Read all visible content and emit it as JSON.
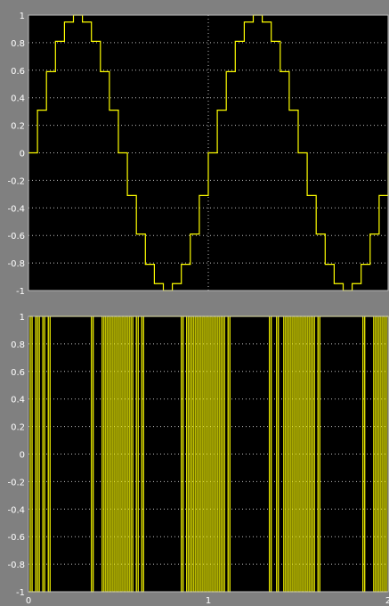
{
  "colors": {
    "figure_background": "#808080",
    "axes_background": "#000000",
    "trace": "#ffff00",
    "grid": "#bdbdbd",
    "tick_text": "#ffffff"
  },
  "chart_data": [
    {
      "type": "line",
      "step": true,
      "title": "",
      "xlabel": "",
      "ylabel": "",
      "xlim": [
        0,
        2
      ],
      "ylim": [
        -1,
        1
      ],
      "grid": true,
      "x_ticks": [
        0,
        1,
        2
      ],
      "x_tick_labels": [
        "",
        "",
        ""
      ],
      "y_ticks": [
        1,
        0.8,
        0.6,
        0.4,
        0.2,
        0,
        -0.2,
        -0.4,
        -0.6,
        -0.8,
        -1
      ],
      "y_tick_labels": [
        "1",
        "0.8",
        "0.6",
        "0.4",
        "0.2",
        "0",
        "-0.2",
        "-0.4",
        "-0.6",
        "-0.8",
        "-1"
      ],
      "series": [
        {
          "x": [
            0,
            0.05,
            0.1,
            0.15,
            0.2,
            0.25,
            0.3,
            0.35,
            0.4,
            0.45,
            0.5,
            0.55,
            0.6,
            0.65,
            0.7,
            0.75,
            0.8,
            0.85,
            0.9,
            0.95,
            1.0,
            1.05,
            1.1,
            1.15,
            1.2,
            1.25,
            1.3,
            1.35,
            1.4,
            1.45,
            1.5,
            1.55,
            1.6,
            1.65,
            1.7,
            1.75,
            1.8,
            1.85,
            1.9,
            1.95,
            2.0
          ],
          "values": [
            0,
            0.31,
            0.59,
            0.81,
            0.95,
            1.0,
            0.95,
            0.81,
            0.59,
            0.31,
            0,
            -0.31,
            -0.59,
            -0.81,
            -0.95,
            -1.0,
            -0.95,
            -0.81,
            -0.59,
            -0.31,
            0,
            0.31,
            0.59,
            0.81,
            0.95,
            1.0,
            0.95,
            0.81,
            0.59,
            0.31,
            0,
            -0.31,
            -0.59,
            -0.81,
            -0.95,
            -1.0,
            -0.95,
            -0.81,
            -0.59,
            -0.31,
            0
          ]
        }
      ]
    },
    {
      "type": "line",
      "step": true,
      "title": "",
      "xlabel": "",
      "ylabel": "",
      "xlim": [
        0,
        2
      ],
      "ylim": [
        -1,
        1
      ],
      "grid": true,
      "x_ticks": [
        0,
        1,
        2
      ],
      "x_tick_labels": [
        "0",
        "1",
        "2"
      ],
      "y_ticks": [
        1,
        0.8,
        0.6,
        0.4,
        0.2,
        0,
        -0.2,
        -0.4,
        -0.6,
        -0.8,
        -1
      ],
      "y_tick_labels": [
        "1",
        "0.8",
        "0.6",
        "0.4",
        "0.2",
        "0",
        "-0.2",
        "-0.4",
        "-0.6",
        "-0.8",
        "-1"
      ],
      "series": [
        {
          "x": [
            0,
            0.01,
            0.02,
            0.04,
            0.05,
            0.06,
            0.08,
            0.09,
            0.11,
            0.12,
            0.35,
            0.36,
            0.41,
            0.42,
            0.43,
            0.44,
            0.45,
            0.46,
            0.47,
            0.48,
            0.49,
            0.5,
            0.51,
            0.52,
            0.53,
            0.54,
            0.55,
            0.56,
            0.57,
            0.58,
            0.6,
            0.61,
            0.63,
            0.64,
            0.85,
            0.86,
            0.88,
            0.89,
            0.9,
            0.91,
            0.92,
            0.93,
            0.94,
            0.95,
            0.96,
            0.97,
            0.98,
            0.99,
            1.0,
            1.01,
            1.02,
            1.03,
            1.04,
            1.05,
            1.06,
            1.07,
            1.08,
            1.09,
            1.11,
            1.12,
            1.34,
            1.35,
            1.38,
            1.39,
            1.42,
            1.43,
            1.44,
            1.45,
            1.46,
            1.47,
            1.48,
            1.49,
            1.5,
            1.51,
            1.52,
            1.53,
            1.54,
            1.55,
            1.56,
            1.57,
            1.58,
            1.59,
            1.61,
            1.62,
            1.86,
            1.87,
            1.92,
            1.93,
            1.94,
            1.95,
            1.96,
            1.97,
            1.98,
            1.99,
            2.0
          ],
          "values": [
            -1,
            1,
            -1,
            1,
            -1,
            1,
            -1,
            1,
            -1,
            1,
            -1,
            1,
            -1,
            1,
            -1,
            1,
            -1,
            1,
            -1,
            1,
            -1,
            1,
            -1,
            1,
            -1,
            1,
            -1,
            1,
            -1,
            1,
            -1,
            1,
            -1,
            1,
            -1,
            1,
            -1,
            1,
            -1,
            1,
            -1,
            1,
            -1,
            1,
            -1,
            1,
            -1,
            1,
            -1,
            1,
            -1,
            1,
            -1,
            1,
            -1,
            1,
            -1,
            1,
            -1,
            1,
            -1,
            1,
            -1,
            1,
            -1,
            1,
            -1,
            1,
            -1,
            1,
            -1,
            1,
            -1,
            1,
            -1,
            1,
            -1,
            1,
            -1,
            1,
            -1,
            1,
            -1,
            1,
            -1,
            1,
            -1,
            1,
            -1,
            1,
            -1,
            1,
            -1,
            1,
            -1
          ]
        }
      ]
    }
  ]
}
